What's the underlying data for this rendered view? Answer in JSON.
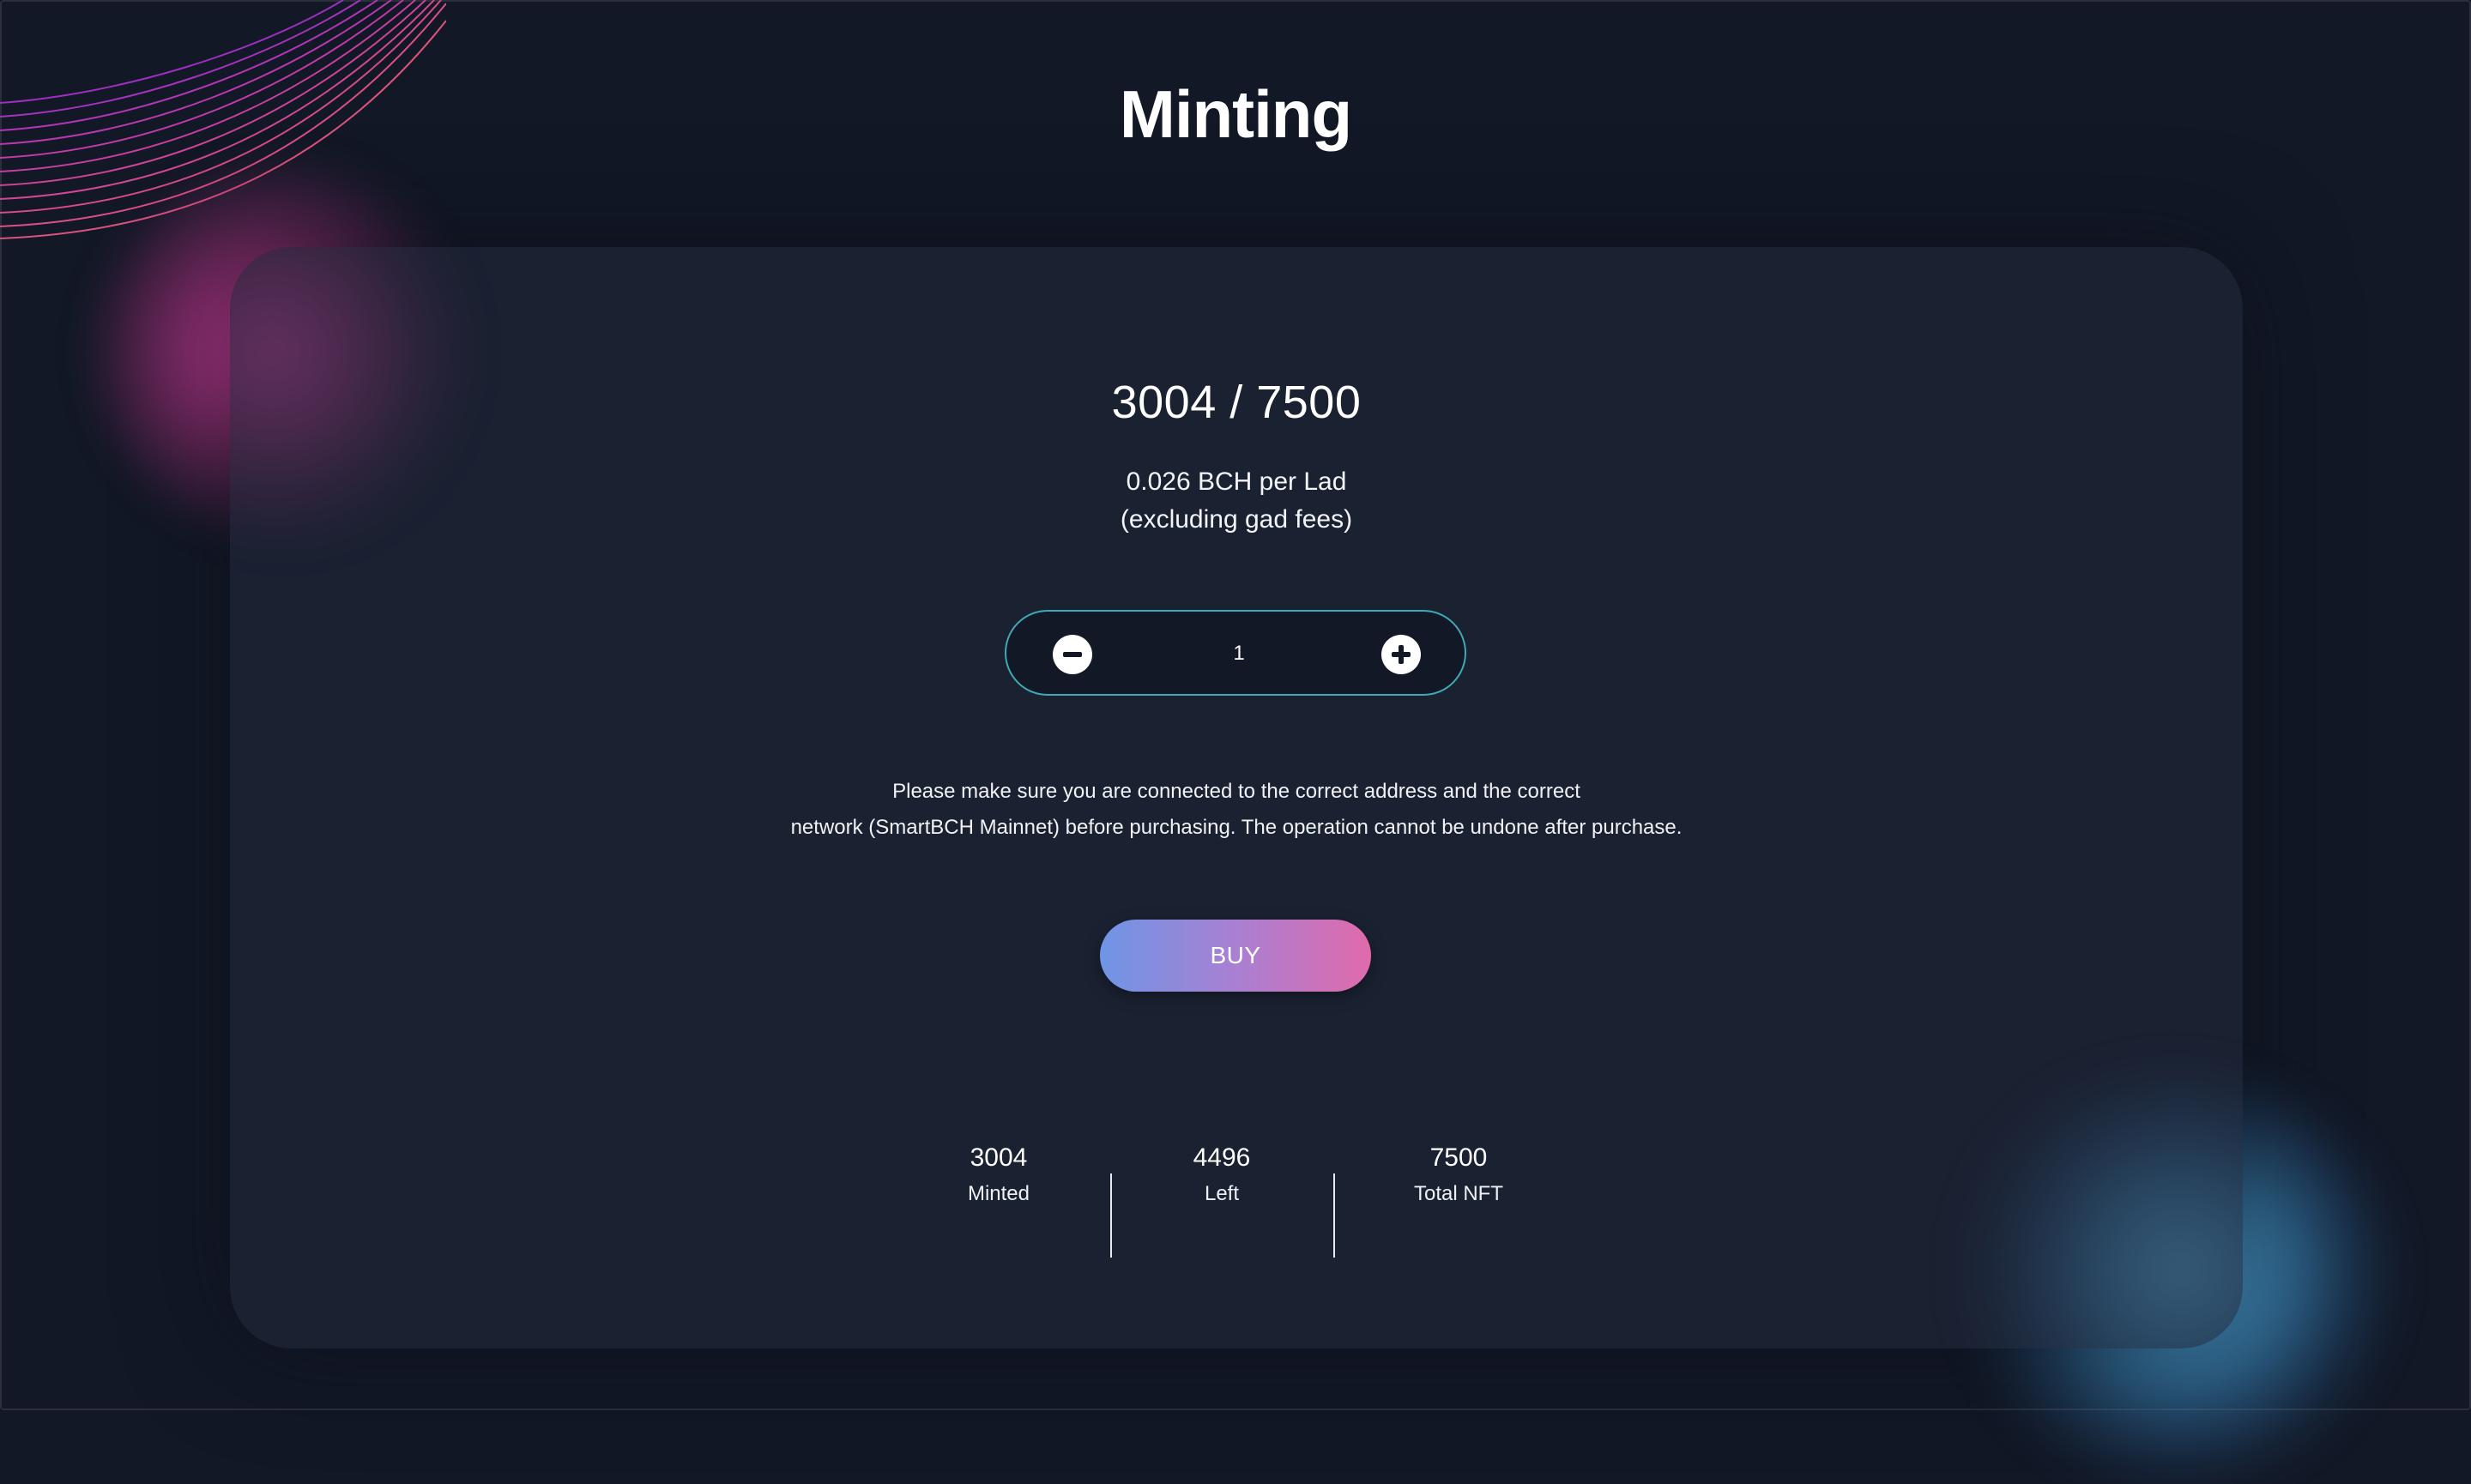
{
  "page": {
    "title": "Minting"
  },
  "mint": {
    "progress": "3004 / 7500",
    "price_line1": "0.026 BCH per Lad",
    "price_line2": "(excluding gad fees)",
    "quantity": "1",
    "notice_line1": "Please make sure you are connected to the correct address and the correct",
    "notice_line2": "network (SmartBCH Mainnet) before purchasing. The operation cannot be undone after purchase.",
    "buy_label": "BUY"
  },
  "stats": [
    {
      "value": "3004",
      "label": "Minted"
    },
    {
      "value": "4496",
      "label": "Left"
    },
    {
      "value": "7500",
      "label": "Total NFT"
    }
  ],
  "colors": {
    "background": "#121826",
    "card": "#1e2535",
    "stepper_border": "#3fa9b5",
    "button_gradient_start": "#6f95e6",
    "button_gradient_end": "#e06aab",
    "glow_pink": "#da40a0",
    "glow_blue": "#5fbef0"
  },
  "icons": {
    "decrement": "minus-circle-icon",
    "increment": "plus-circle-icon"
  }
}
